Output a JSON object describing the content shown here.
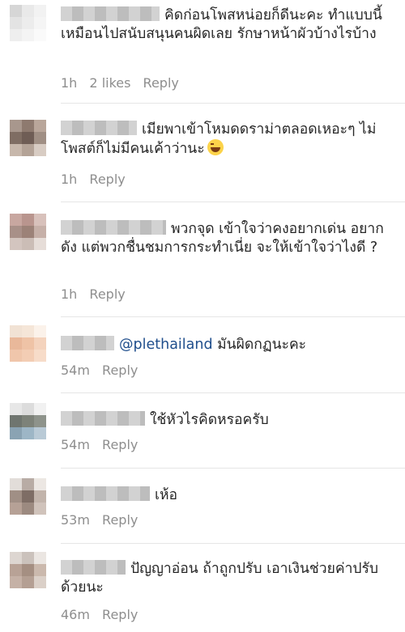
{
  "comments": [
    {
      "text": "คิดก่อนโพสหน่อยก็ดีนะคะ ทำแบบนี้เหมือนไปสนับสนุนคนผิดเลย รักษาหน้าผัวบ้างไรบ้าง",
      "time": "1h",
      "likes": "2 likes",
      "reply": "Reply",
      "avatar": [
        "#d6d6d6",
        "#e9e9e9",
        "#f2f2f2",
        "#e3e3e3",
        "#ececec",
        "#f5f5f5",
        "#eeeeee",
        "#f4f4f4",
        "#fafafa"
      ]
    },
    {
      "text": "เมียพาเข้าโหมดดราม่าตลอดเหอะๆ ไม่โพสต์ก็ไม่มีคนเค้าว่านะ",
      "time": "1h",
      "reply": "Reply",
      "avatar": [
        "#a8978d",
        "#8e7a6f",
        "#b9a69a",
        "#7f6d63",
        "#6f5d55",
        "#a08f84",
        "#c7b7ab",
        "#b4a397",
        "#d8ccc3"
      ]
    },
    {
      "text": "พวกจุด เข้าใจว่าคงอยากเด่น อยากดัง แต่พวกชื่นชมการกระทำเนี่ย จะให้เข้าใจว่าไงดี ?",
      "time": "1h",
      "reply": "Reply",
      "avatar": [
        "#c8a7a0",
        "#b9958e",
        "#d8c1bb",
        "#a89088",
        "#9c8278",
        "#c6b0a8",
        "#d3c5bf",
        "#cbbdb6",
        "#e6ddd8"
      ]
    },
    {
      "mention": "@plethailand",
      "text": "มันผิดกฏนะคะ",
      "time": "54m",
      "reply": "Reply",
      "avatar": [
        "#f1e2d4",
        "#f5e6d8",
        "#fbf2ea",
        "#e9b89a",
        "#efc3a6",
        "#f4d3bd",
        "#f0c6ab",
        "#f3cdb4",
        "#f7dcc9"
      ]
    },
    {
      "text": "ใช้หัวไรคิดหรอครับ",
      "time": "54m",
      "reply": "Reply",
      "avatar": [
        "#e7e7e7",
        "#dcdcdc",
        "#f1f1f1",
        "#6f756f",
        "#7d8279",
        "#8e938b",
        "#8aa3b3",
        "#9db6c6",
        "#b9cad6"
      ]
    },
    {
      "text": "เห้อ",
      "time": "53m",
      "reply": "Reply",
      "avatar": [
        "#e2ddd9",
        "#b8aca5",
        "#ece7e3",
        "#a08f85",
        "#7e6d65",
        "#c2b4ab",
        "#b6a196",
        "#9c8a80",
        "#d0c3bb"
      ]
    },
    {
      "text": "ปัญญาอ่อน ถ้าถูกปรับ เอาเงินช่วยค่าปรับด้วยนะ",
      "time": "46m",
      "reply": "Reply",
      "avatar": [
        "#ddd6d1",
        "#cbc2bc",
        "#ebe6e2",
        "#b8a296",
        "#a58f82",
        "#cbb9ad",
        "#c5b1a6",
        "#b49f93",
        "#dbd0c8"
      ]
    }
  ]
}
